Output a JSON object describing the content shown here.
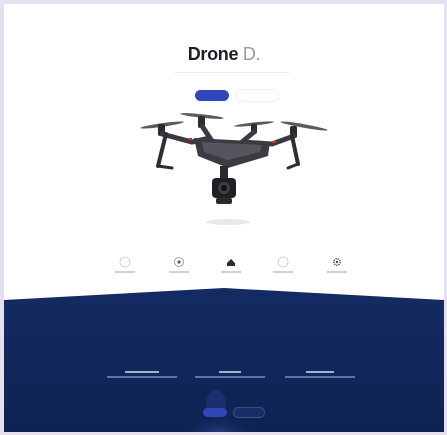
{
  "hero": {
    "title": "Drone",
    "title_suffix": "D."
  }
}
